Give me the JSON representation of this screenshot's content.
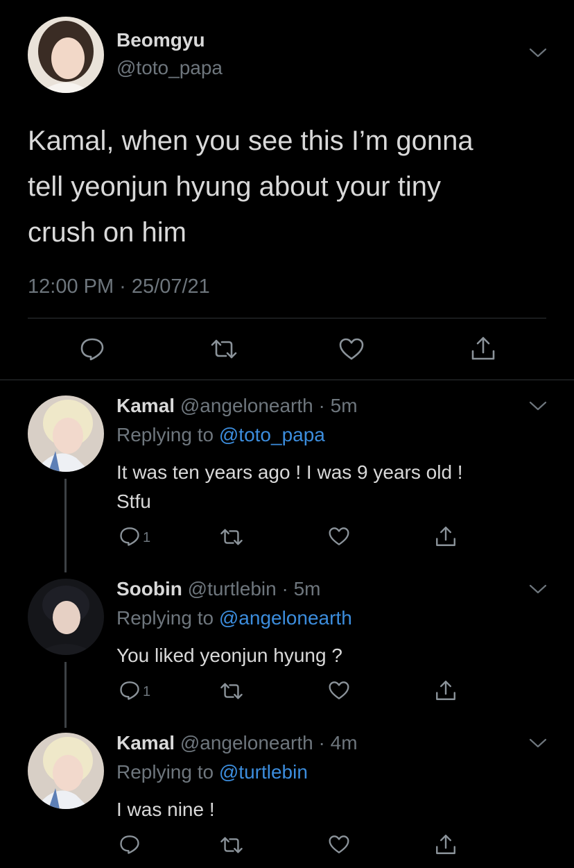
{
  "main_tweet": {
    "display_name": "Beomgyu",
    "handle": "@toto_papa",
    "text_lines": [
      "Kamal, when you see this I’m gonna",
      "tell yeonjun hyung about your tiny",
      "crush on him"
    ],
    "timestamp": "12:00 PM · 25/07/21"
  },
  "replies": [
    {
      "display_name": "Kamal",
      "handle": "@angelonearth",
      "time": "· 5m",
      "replying_prefix": "Replying to",
      "replying_to": "@toto_papa",
      "text_lines": [
        "It was ten years ago ! I was 9 years old !",
        "Stfu"
      ],
      "reply_count": "1"
    },
    {
      "display_name": "Soobin",
      "handle": "@turtlebin",
      "time": "· 5m",
      "replying_prefix": "Replying to",
      "replying_to": "@angelonearth",
      "text_lines": [
        "You liked yeonjun hyung ?"
      ],
      "reply_count": "1"
    },
    {
      "display_name": "Kamal",
      "handle": "@angelonearth",
      "time": "· 4m",
      "replying_prefix": "Replying to",
      "replying_to": "@turtlebin",
      "text_lines": [
        "I was nine !"
      ],
      "reply_count": ""
    }
  ],
  "icons": {
    "reply": "reply-icon",
    "retweet": "retweet-icon",
    "like": "like-icon",
    "share": "share-icon",
    "more": "chevron-down-icon"
  },
  "colors": {
    "background": "#000000",
    "text": "#d9d9d9",
    "muted": "#6e767d",
    "link": "#3c8ddd",
    "divider": "#2f3336"
  }
}
